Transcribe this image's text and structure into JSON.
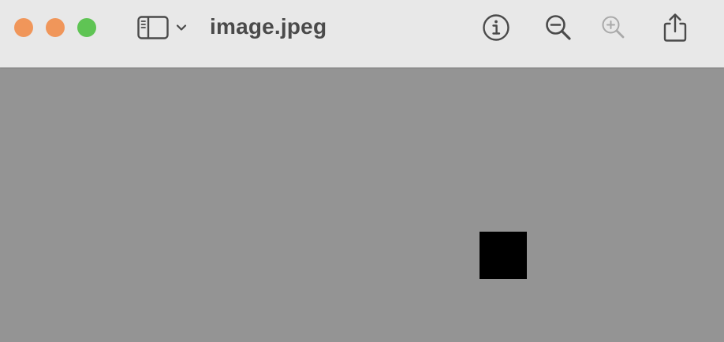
{
  "window": {
    "title": "image.jpeg",
    "traffic_lights": {
      "close_color": "#f0965a",
      "minimize_color": "#f0965a",
      "zoom_color": "#5fc454"
    }
  },
  "toolbar": {
    "sidebar_toggle_icon": "sidebar-icon",
    "sidebar_menu_icon": "chevron-down-icon",
    "buttons": [
      {
        "name": "info",
        "icon": "info-circle-icon",
        "enabled": true
      },
      {
        "name": "zoom-out",
        "icon": "zoom-out-icon",
        "enabled": true
      },
      {
        "name": "zoom-in",
        "icon": "zoom-in-icon",
        "enabled": false
      },
      {
        "name": "share",
        "icon": "share-icon",
        "enabled": true
      }
    ]
  },
  "canvas": {
    "background_color": "#949494",
    "image_color": "#000000"
  }
}
